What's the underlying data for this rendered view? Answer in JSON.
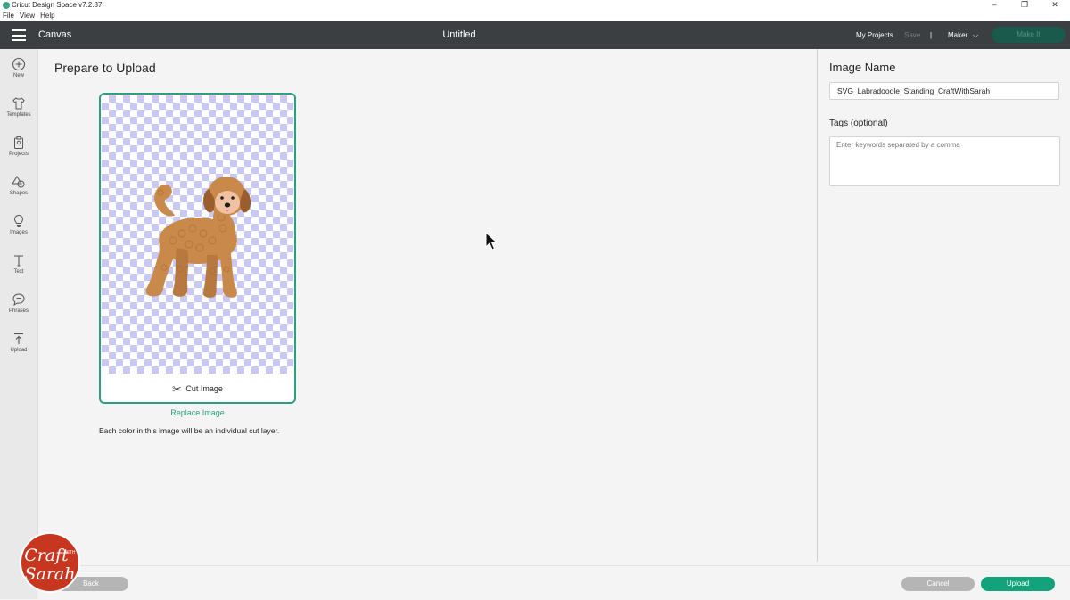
{
  "window": {
    "title": "Cricut Design Space  v7.2.87",
    "controls": [
      "–",
      "❐",
      "✕"
    ]
  },
  "menubar": {
    "items": [
      "File",
      "View",
      "Help"
    ]
  },
  "header": {
    "section": "Canvas",
    "document_title": "Untitled",
    "my_projects": "My Projects",
    "save": "Save",
    "divider": "|",
    "machine": "Maker",
    "machine_chevron": "⌵",
    "make_it": "Make It"
  },
  "sidebar": {
    "items": [
      {
        "label": "New",
        "icon": "plus-circle-icon"
      },
      {
        "label": "Templates",
        "icon": "shirt-icon"
      },
      {
        "label": "Projects",
        "icon": "clipboard-icon"
      },
      {
        "label": "Shapes",
        "icon": "shapes-icon"
      },
      {
        "label": "Images",
        "icon": "lightbulb-icon"
      },
      {
        "label": "Text",
        "icon": "text-icon"
      },
      {
        "label": "Phrases",
        "icon": "speech-bubble-icon"
      },
      {
        "label": "Upload",
        "icon": "upload-icon"
      }
    ]
  },
  "main": {
    "title": "Prepare to Upload",
    "cut_image_label": "Cut Image",
    "replace_image": "Replace Image",
    "note": "Each color in this image will be an individual cut layer."
  },
  "right": {
    "image_name_title": "Image Name",
    "image_name_value": "SVG_Labradoodle_Standing_CraftWithSarah",
    "tags_label": "Tags (optional)",
    "tags_placeholder": "Enter keywords separated by a comma"
  },
  "footer": {
    "back": "Back",
    "cancel": "Cancel",
    "upload": "Upload"
  },
  "watermark": {
    "line1": "Craft",
    "line2": "WITH",
    "line3": "Sarah"
  },
  "colors": {
    "header_bg": "#3b3f42",
    "accent": "#2e9e83",
    "upload_button": "#12a37b",
    "make_it_button": "#1a5a4c",
    "checker": "#c9c9f3",
    "dog_body": "#c8894a",
    "watermark_bg": "#c7361f"
  }
}
